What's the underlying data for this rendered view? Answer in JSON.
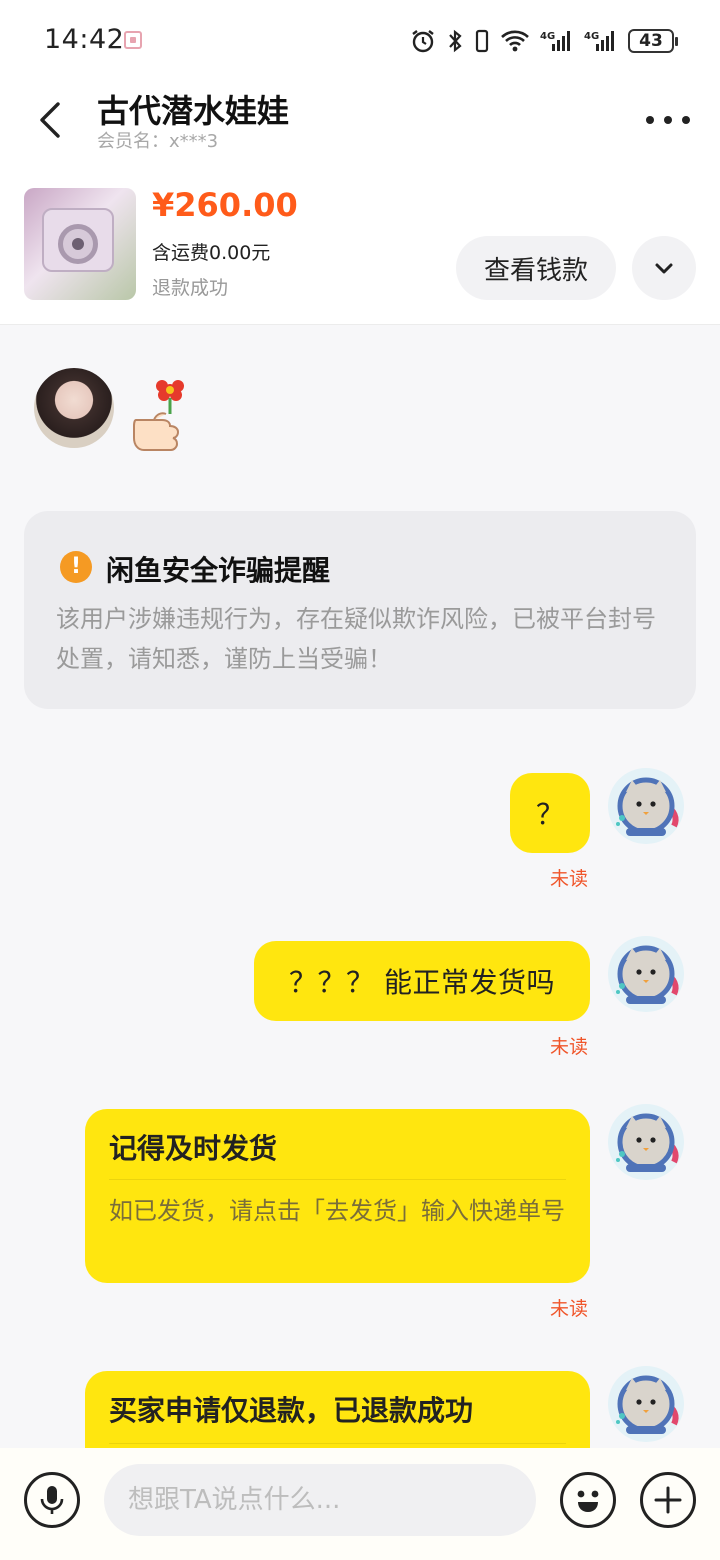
{
  "status_bar": {
    "time": "14:42",
    "battery": "43",
    "network_label": "4G"
  },
  "header": {
    "title": "古代潜水娃娃",
    "member": "会员名：x***3"
  },
  "product": {
    "price": "¥260.00",
    "shipping": "含运费0.00元",
    "status": "退款成功",
    "view_button": "查看钱款"
  },
  "warning": {
    "title": "闲鱼安全诈骗提醒",
    "body": "该用户涉嫌违规行为，存在疑似欺诈风险，已被平台封号处置，请知悉，谨防上当受骗！"
  },
  "messages": [
    {
      "text": "？",
      "status": "未读"
    },
    {
      "text": "？？？ 能正常发货吗",
      "status": "未读"
    },
    {
      "title": "记得及时发货",
      "body": "如已发货，请点击「去发货」输入快递单号",
      "status": "未读"
    },
    {
      "title": "买家申请仅退款，已退款成功"
    }
  ],
  "input": {
    "placeholder": "想跟TA说点什么..."
  },
  "colors": {
    "accent_yellow": "#ffe60f",
    "price_orange": "#ff5b1a",
    "unread_red": "#f0552a",
    "warning_orange": "#f59a23"
  }
}
